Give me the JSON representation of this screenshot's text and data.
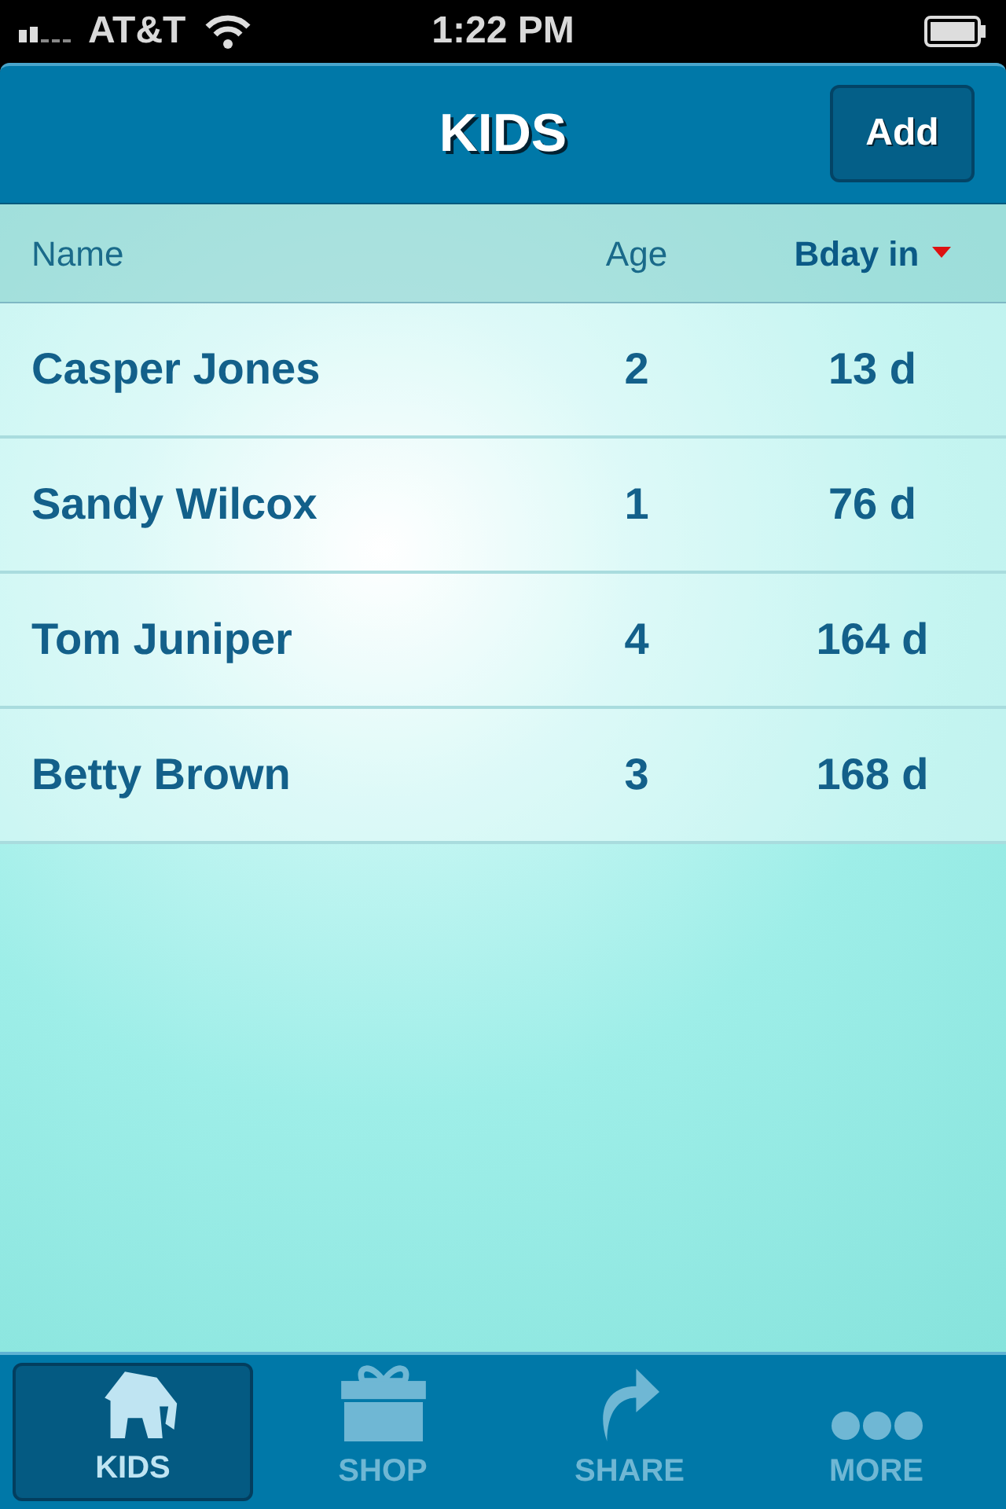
{
  "status_bar": {
    "carrier": "AT&T",
    "time": "1:22 PM"
  },
  "nav_bar": {
    "title": "KIDS",
    "action": "Add"
  },
  "table": {
    "columns": [
      {
        "label": "Name",
        "sorted": false
      },
      {
        "label": "Age",
        "sorted": false
      },
      {
        "label": "Bday in",
        "sorted": true
      }
    ],
    "rows": [
      [
        "Casper Jones",
        "2",
        "13 d"
      ],
      [
        "Sandy Wilcox",
        "1",
        "76 d"
      ],
      [
        "Tom Juniper",
        "4",
        "164 d"
      ],
      [
        "Betty Brown",
        "3",
        "168 d"
      ]
    ]
  },
  "tab_bar": [
    {
      "label": "KIDS",
      "kind": "elephant",
      "selected": true
    },
    {
      "label": "SHOP",
      "kind": "gift",
      "selected": false
    },
    {
      "label": "SHARE",
      "kind": "share",
      "selected": false
    },
    {
      "label": "MORE",
      "kind": "more",
      "selected": false
    }
  ]
}
